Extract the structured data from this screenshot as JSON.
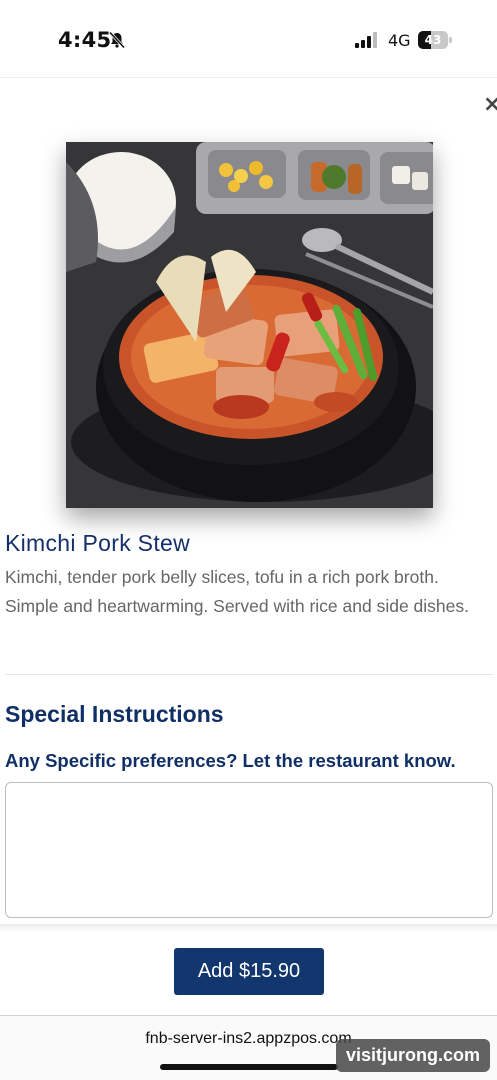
{
  "status_bar": {
    "time": "4:45",
    "network": "4G",
    "battery_level": "43",
    "battery_fraction": 0.43
  },
  "icons": {
    "bell": "bell-muted-icon",
    "signal": "signal-icon",
    "close": "close-icon"
  },
  "close_label": "×",
  "item": {
    "title": "Kimchi Pork Stew",
    "description": "Kimchi, tender pork belly slices, tofu in a rich pork broth. Simple and heartwarming. Served with rice and side dishes."
  },
  "special_instructions": {
    "heading": "Special Instructions",
    "prompt": "Any Specific preferences? Let the restaurant know.",
    "value": ""
  },
  "footer": {
    "add_button_label": "Add $15.90"
  },
  "browser": {
    "url": "fnb-server-ins2.appzpos.com"
  },
  "watermark": "visitjurong.com",
  "colors": {
    "brand_navy": "#12376e",
    "title_blue": "#14306b"
  }
}
